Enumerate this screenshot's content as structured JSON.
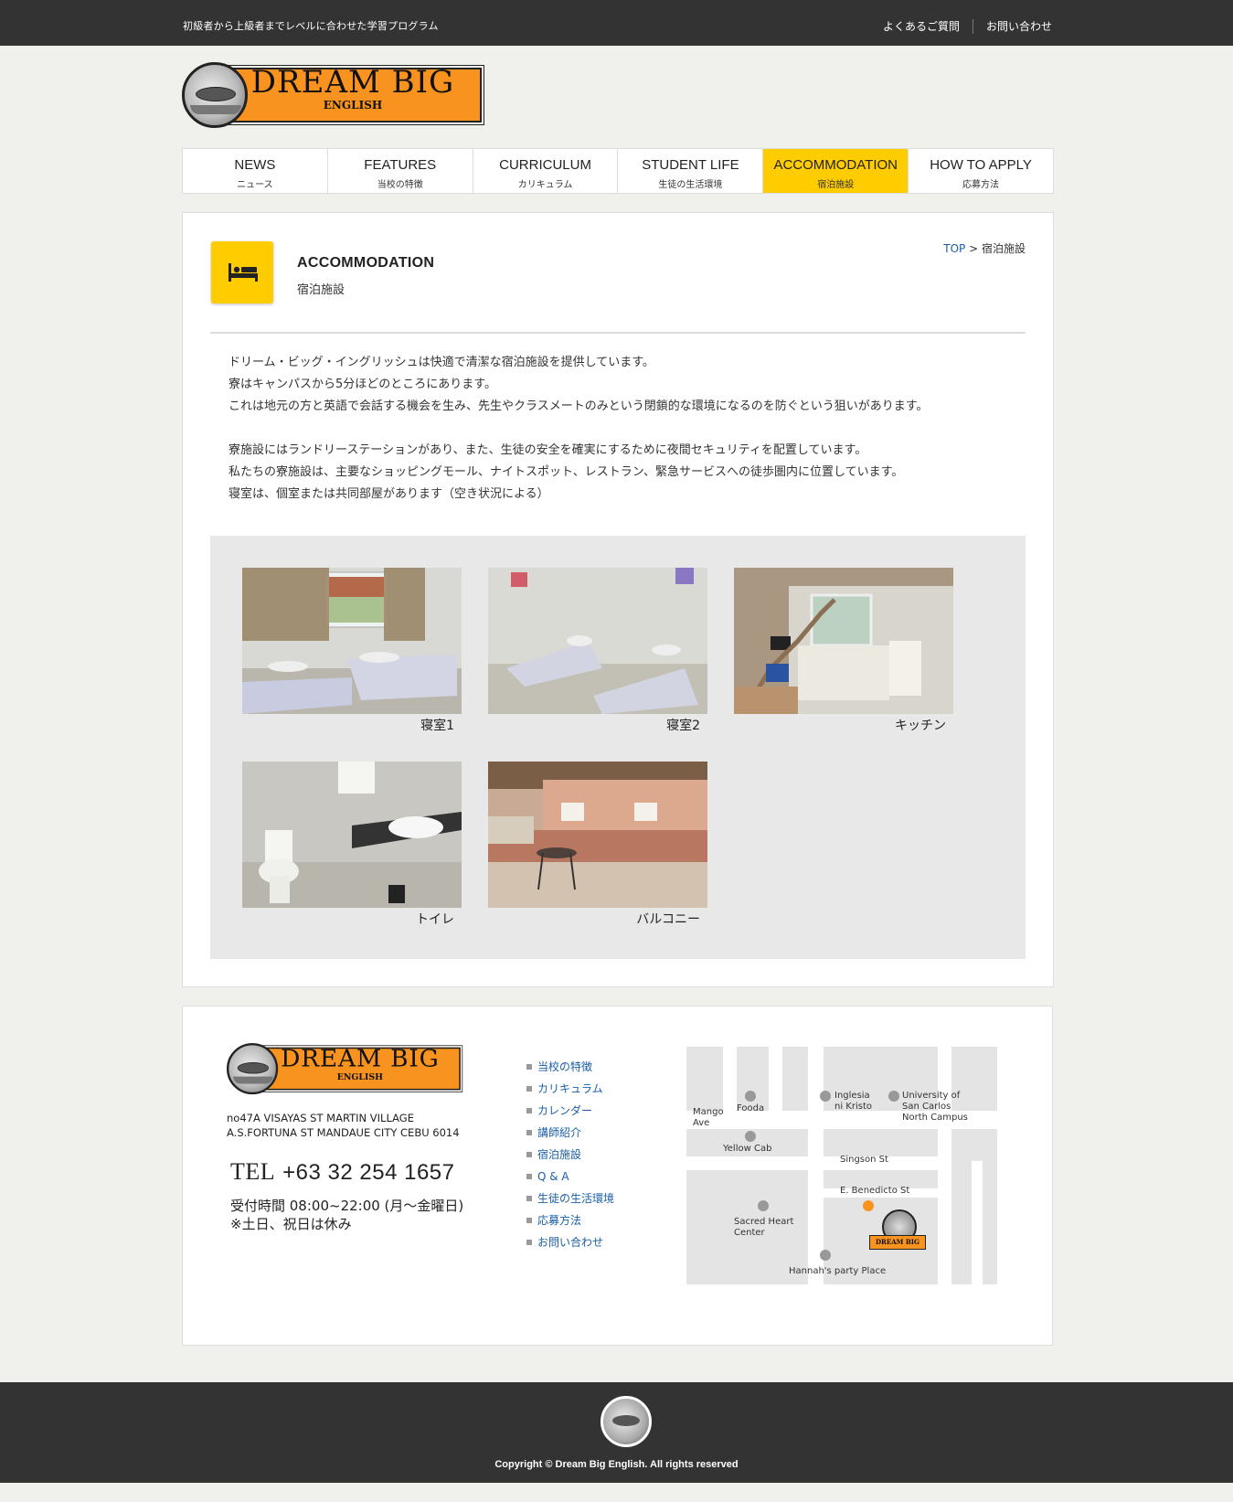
{
  "topbar": {
    "tagline": "初級者から上級者までレベルに合わせた学習プログラム",
    "links": [
      "よくあるご質問",
      "お問い合わせ"
    ]
  },
  "logo": {
    "title": "DREAM BIG",
    "sub": "ENGLISH"
  },
  "nav": [
    {
      "en": "NEWS",
      "ja": "ニュース"
    },
    {
      "en": "FEATURES",
      "ja": "当校の特徴"
    },
    {
      "en": "CURRICULUM",
      "ja": "カリキュラム"
    },
    {
      "en": "STUDENT LIFE",
      "ja": "生徒の生活環境"
    },
    {
      "en": "ACCOMMODATION",
      "ja": "宿泊施設"
    },
    {
      "en": "HOW TO APPLY",
      "ja": "応募方法"
    }
  ],
  "page": {
    "title": "ACCOMMODATION",
    "subtitle": "宿泊施設",
    "breadcrumb": {
      "home": "TOP",
      "sep": ">",
      "current": "宿泊施設"
    }
  },
  "intro": {
    "para1": [
      "ドリーム・ビッグ・イングリッシュは快適で清潔な宿泊施設を提供しています。",
      "寮はキャンパスから5分ほどのところにあります。",
      "これは地元の方と英語で会話する機会を生み、先生やクラスメートのみという閉鎖的な環境になるのを防ぐという狙いがあります。"
    ],
    "para2": [
      "寮施設にはランドリーステーションがあり、また、生徒の安全を確実にするために夜間セキュリティを配置しています。",
      "私たちの寮施設は、主要なショッピングモール、ナイトスポット、レストラン、緊急サービスへの徒歩圏内に位置しています。",
      "寝室は、個室または共同部屋があります（空き状況による）"
    ]
  },
  "gallery": [
    {
      "caption": "寝室1"
    },
    {
      "caption": "寝室2"
    },
    {
      "caption": "キッチン"
    },
    {
      "caption": "トイレ"
    },
    {
      "caption": "バルコニー"
    }
  ],
  "footer": {
    "address": [
      "no47A VISAYAS ST MARTIN VILLAGE",
      "A.S.FORTUNA ST MANDAUE CITY CEBU 6014"
    ],
    "tel_label": "TEL",
    "tel": "+63 32 254 1657",
    "hours": "受付時間 08:00~22:00 (月～金曜日)",
    "closed": "※土日、祝日は休み",
    "links": [
      "当校の特徴",
      "カリキュラム",
      "カレンダー",
      "講師紹介",
      "宿泊施設",
      "Q & A",
      "生徒の生活環境",
      "応募方法",
      "お問い合わせ"
    ],
    "map": {
      "mango": [
        "Mango",
        "Ave"
      ],
      "fooda": "Fooda",
      "iglesia": [
        "Inglesia",
        "ni Kristo"
      ],
      "usc": [
        "University of",
        "San Carlos",
        "North Campus"
      ],
      "yellowcab": "Yellow Cab",
      "singson": "Singson St",
      "benedicto": "E. Benedicto St",
      "sacred": [
        "Sacred Heart",
        "Center"
      ],
      "hannah": "Hannah's party Place",
      "minilogo": "DREAM BIG"
    }
  },
  "copyright": "Copyright © Dream Big English. All rights reserved",
  "colors": {
    "accent": "#ffcc00",
    "logo_orange": "#f7931e",
    "dark": "#333333",
    "link": "#1a5fa8"
  }
}
